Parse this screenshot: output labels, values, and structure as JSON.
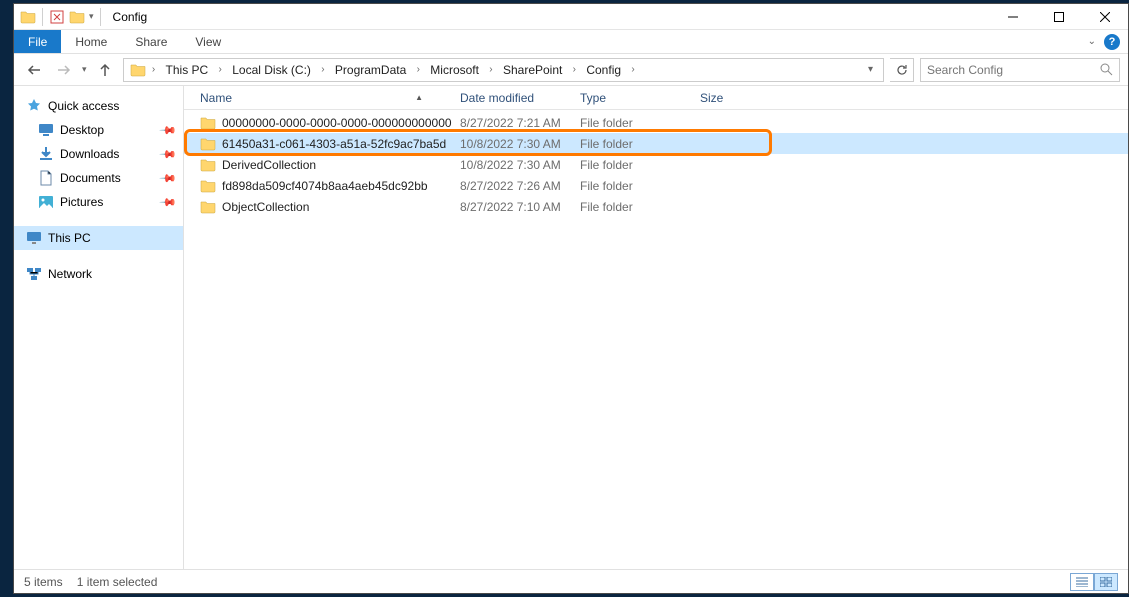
{
  "window": {
    "title": "Config"
  },
  "ribbon": {
    "file": "File",
    "tabs": [
      "Home",
      "Share",
      "View"
    ]
  },
  "breadcrumb": {
    "items": [
      "This PC",
      "Local Disk (C:)",
      "ProgramData",
      "Microsoft",
      "SharePoint",
      "Config"
    ]
  },
  "search": {
    "placeholder": "Search Config"
  },
  "nav": {
    "quick_access": "Quick access",
    "items": [
      {
        "label": "Desktop",
        "icon": "desktop"
      },
      {
        "label": "Downloads",
        "icon": "downloads"
      },
      {
        "label": "Documents",
        "icon": "documents"
      },
      {
        "label": "Pictures",
        "icon": "pictures"
      }
    ],
    "this_pc": "This PC",
    "network": "Network"
  },
  "columns": {
    "name": "Name",
    "modified": "Date modified",
    "type": "Type",
    "size": "Size"
  },
  "rows": [
    {
      "name": "00000000-0000-0000-0000-000000000000",
      "modified": "8/27/2022 7:21 AM",
      "type": "File folder",
      "selected": false,
      "highlighted": false
    },
    {
      "name": "61450a31-c061-4303-a51a-52fc9ac7ba5d",
      "modified": "10/8/2022 7:30 AM",
      "type": "File folder",
      "selected": true,
      "highlighted": true
    },
    {
      "name": "DerivedCollection",
      "modified": "10/8/2022 7:30 AM",
      "type": "File folder",
      "selected": false,
      "highlighted": false
    },
    {
      "name": "fd898da509cf4074b8aa4aeb45dc92bb",
      "modified": "8/27/2022 7:26 AM",
      "type": "File folder",
      "selected": false,
      "highlighted": false
    },
    {
      "name": "ObjectCollection",
      "modified": "8/27/2022 7:10 AM",
      "type": "File folder",
      "selected": false,
      "highlighted": false
    }
  ],
  "status": {
    "count": "5 items",
    "selection": "1 item selected"
  }
}
